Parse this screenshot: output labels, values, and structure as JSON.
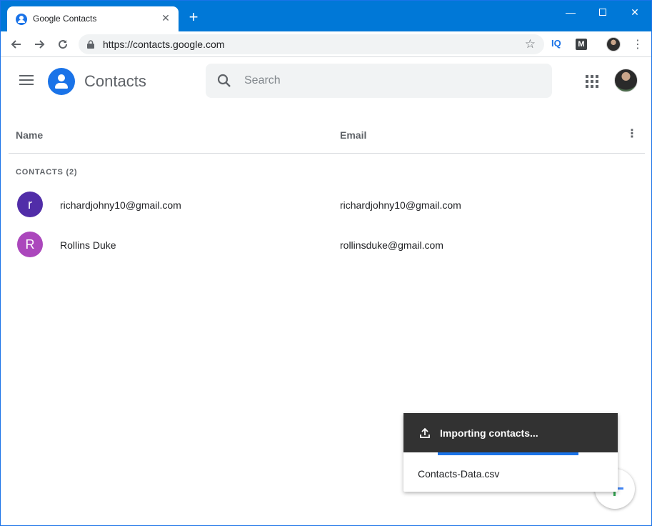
{
  "browser": {
    "tab_title": "Google Contacts",
    "url": "https://contacts.google.com",
    "ext_iq_label": "IQ",
    "ext_m_label": "M",
    "window_controls": {
      "minimize": "—",
      "maximize": "",
      "close": "✕"
    }
  },
  "app": {
    "title": "Contacts",
    "search_placeholder": "Search"
  },
  "list": {
    "columns": {
      "name": "Name",
      "email": "Email"
    },
    "section_label": "CONTACTS (2)",
    "contacts": [
      {
        "initial": "r",
        "name": "richardjohny10@gmail.com",
        "email": "richardjohny10@gmail.com",
        "avatar_color": "#512da8"
      },
      {
        "initial": "R",
        "name": "Rollins Duke",
        "email": "rollinsduke@gmail.com",
        "avatar_color": "#ab47bc"
      }
    ]
  },
  "import_panel": {
    "title": "Importing contacts...",
    "file_name": "Contacts-Data.csv"
  },
  "colors": {
    "accent": "#1a73e8",
    "titlebar": "#0078d7",
    "snackbar": "#323232"
  }
}
